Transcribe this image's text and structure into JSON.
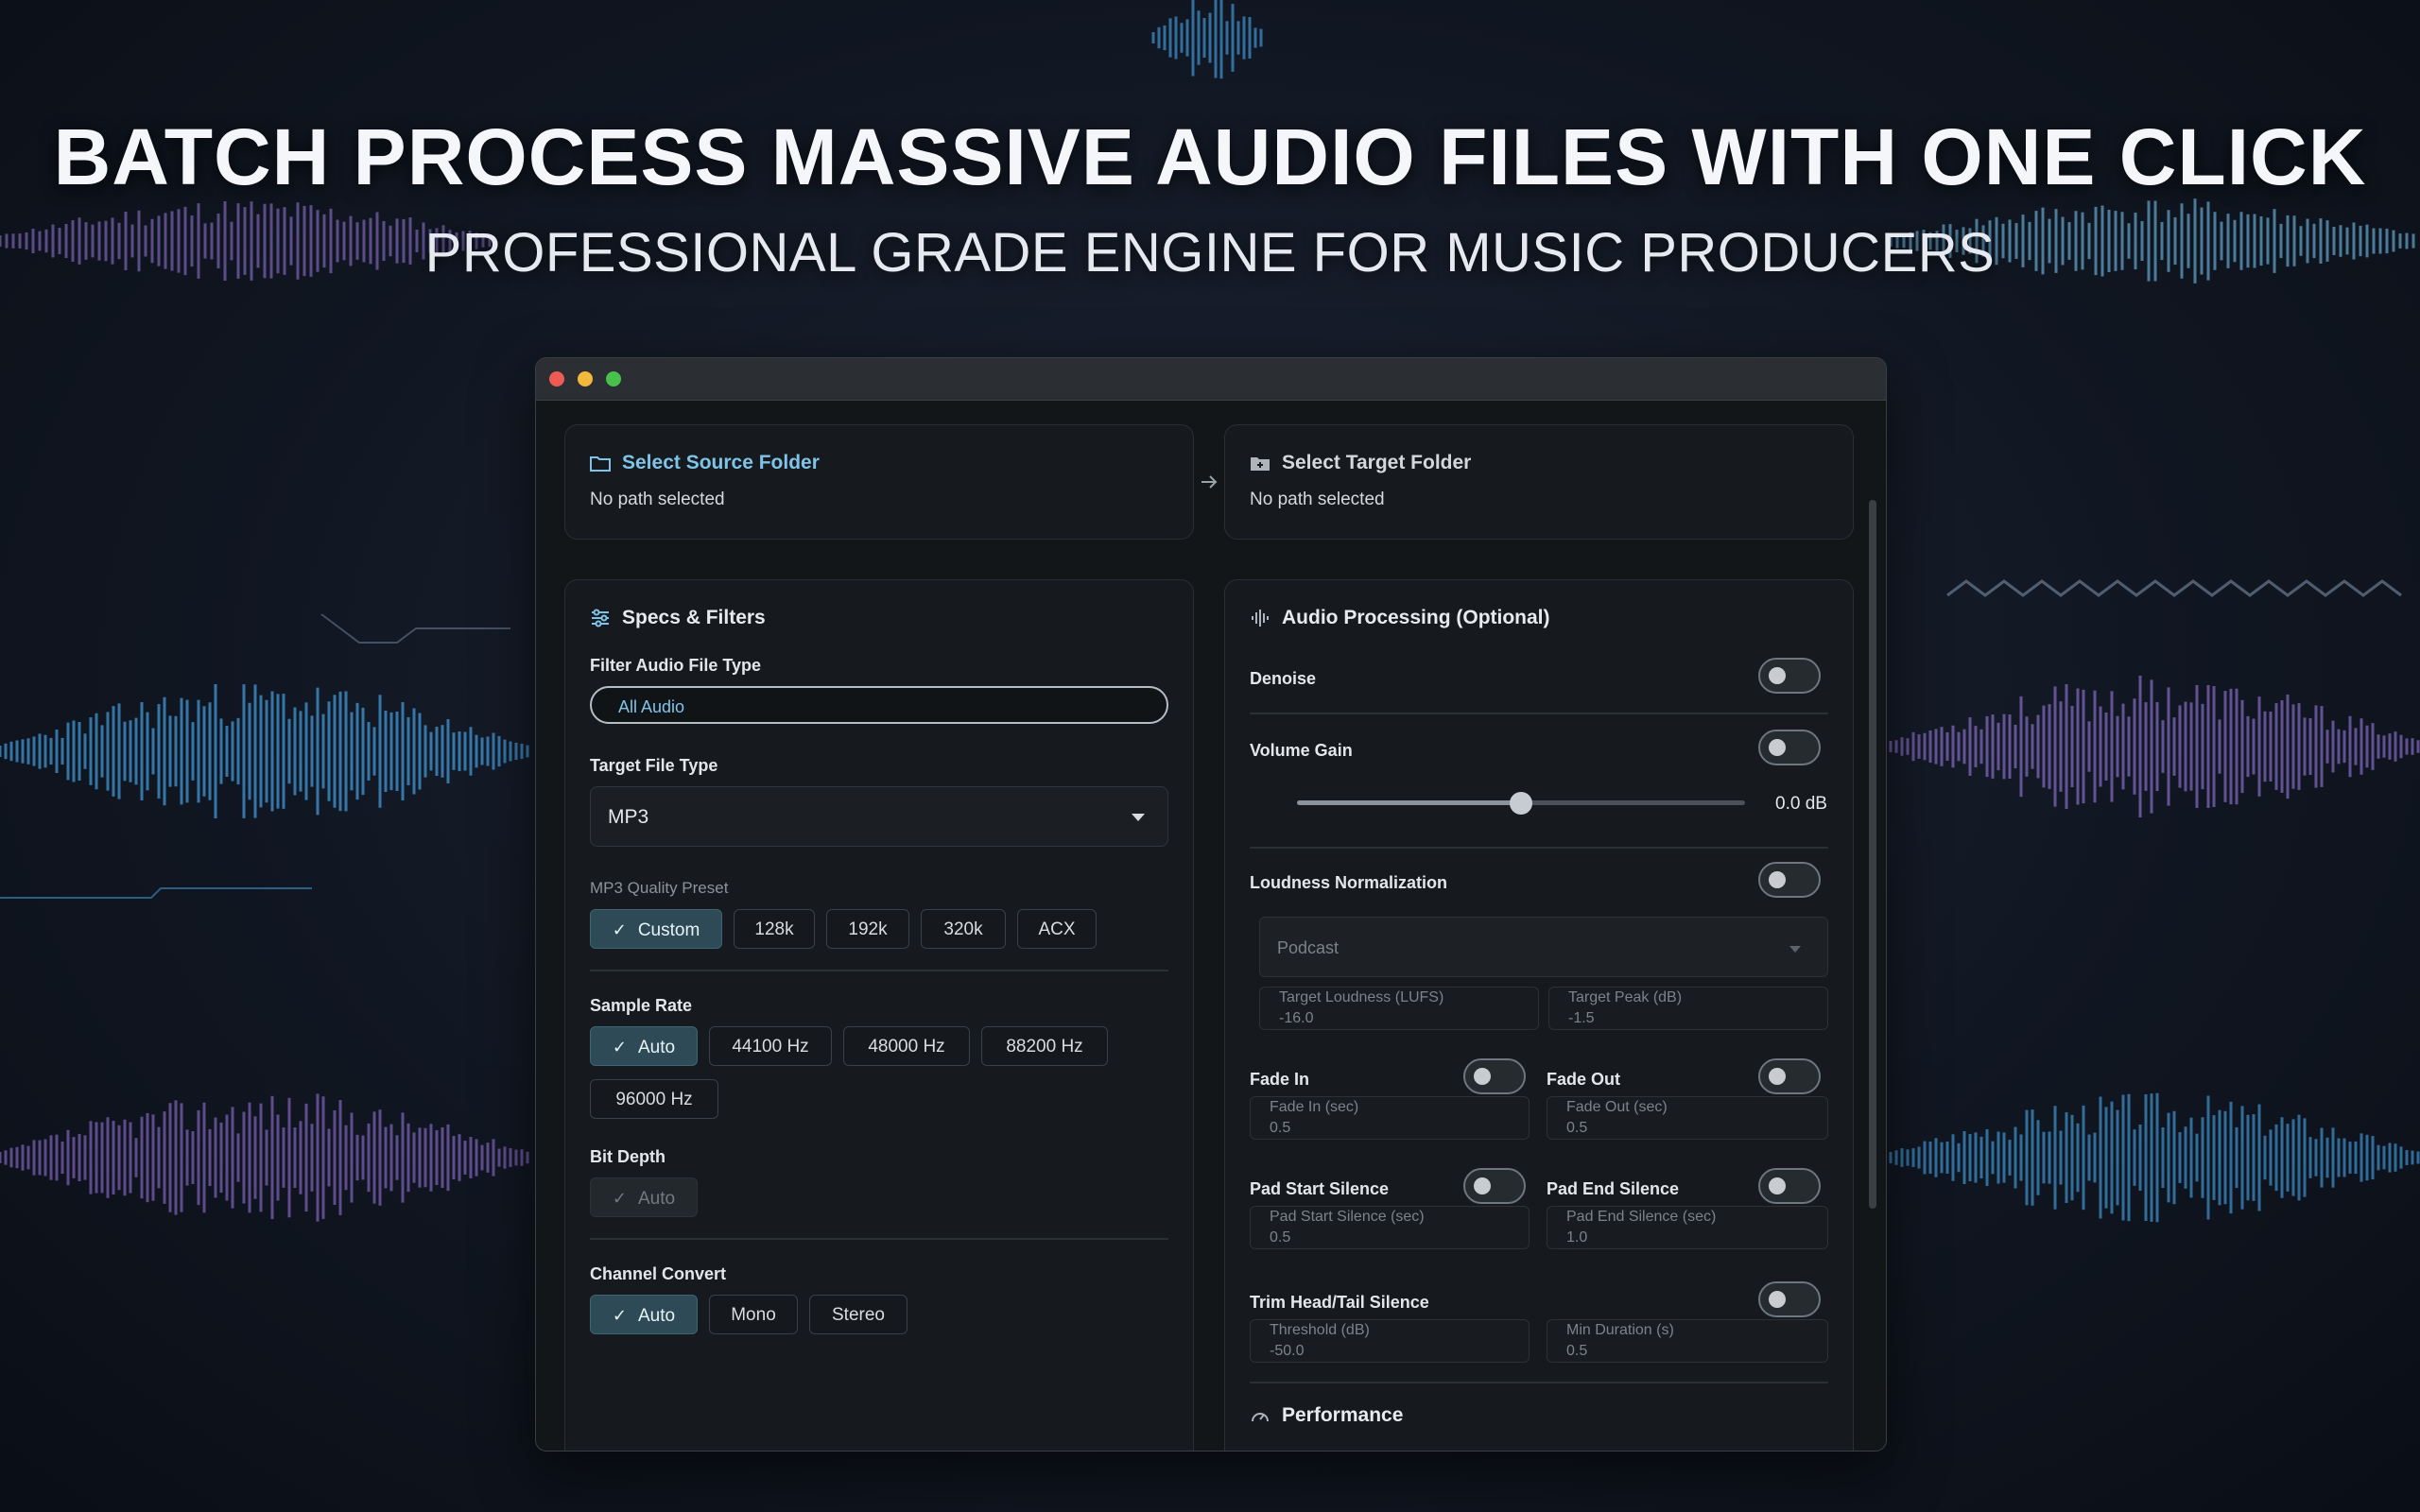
{
  "hero": {
    "title": "BATCH PROCESS MASSIVE AUDIO FILES WITH ONE CLICK",
    "subtitle": "PROFESSIONAL GRADE ENGINE FOR MUSIC PRODUCERS"
  },
  "source": {
    "title": "Select Source Folder",
    "path": "No path selected",
    "icon": "folder-icon"
  },
  "target": {
    "title": "Select Target Folder",
    "path": "No path selected",
    "icon": "folder-plus-icon"
  },
  "specs": {
    "title": "Specs & Filters",
    "filter_label": "Filter Audio File Type",
    "filter_value": "All Audio",
    "target_label": "Target File Type",
    "target_value": "MP3",
    "quality_label": "MP3 Quality Preset",
    "quality_options": [
      "Custom",
      "128k",
      "192k",
      "320k",
      "ACX"
    ],
    "sample_rate_label": "Sample Rate",
    "sample_rates": [
      "Auto",
      "44100 Hz",
      "48000 Hz",
      "88200 Hz",
      "96000 Hz"
    ],
    "bit_depth_label": "Bit Depth",
    "bit_depth_value": "Auto",
    "channel_label": "Channel Convert",
    "channel_options": [
      "Auto",
      "Mono",
      "Stereo"
    ]
  },
  "processing": {
    "title": "Audio Processing (Optional)",
    "denoise": "Denoise",
    "volume_gain": "Volume Gain",
    "volume_value": "0.0 dB",
    "volume_level": 0.5,
    "loudness": "Loudness Normalization",
    "loudness_preset": "Podcast",
    "target_loudness_label": "Target Loudness (LUFS)",
    "target_loudness_value": "-16.0",
    "target_peak_label": "Target Peak (dB)",
    "target_peak_value": "-1.5",
    "fade_in": "Fade In",
    "fade_in_field_label": "Fade In (sec)",
    "fade_in_field_value": "0.5",
    "fade_out": "Fade Out",
    "fade_out_field_label": "Fade Out (sec)",
    "fade_out_field_value": "0.5",
    "pad_start": "Pad Start Silence",
    "pad_start_field_label": "Pad Start Silence (sec)",
    "pad_start_field_value": "0.5",
    "pad_end": "Pad End Silence",
    "pad_end_field_label": "Pad End Silence (sec)",
    "pad_end_field_value": "1.0",
    "trim": "Trim Head/Tail Silence",
    "threshold_label": "Threshold (dB)",
    "threshold_value": "-50.0",
    "min_duration_label": "Min Duration (s)",
    "min_duration_value": "0.5",
    "performance": "Performance"
  },
  "colors": {
    "accent": "#7fc4e8",
    "selected_chip": "#2d4a56",
    "window_bg": "#121619"
  }
}
